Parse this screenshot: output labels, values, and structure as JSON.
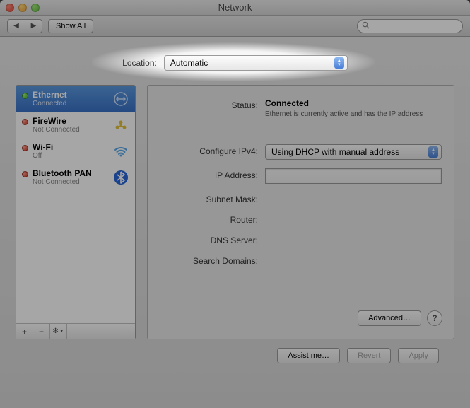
{
  "window": {
    "title": "Network"
  },
  "toolbar": {
    "show_all_label": "Show All",
    "search_placeholder": ""
  },
  "location": {
    "label": "Location:",
    "value": "Automatic"
  },
  "sidebar": {
    "items": [
      {
        "name": "Ethernet",
        "sub": "Connected",
        "status": "green",
        "icon": "ethernet"
      },
      {
        "name": "FireWire",
        "sub": "Not Connected",
        "status": "red",
        "icon": "firewire"
      },
      {
        "name": "Wi-Fi",
        "sub": "Off",
        "status": "red",
        "icon": "wifi"
      },
      {
        "name": "Bluetooth PAN",
        "sub": "Not Connected",
        "status": "red",
        "icon": "bluetooth"
      }
    ],
    "footer": {
      "add": "+",
      "remove": "−",
      "gear": "✻▾"
    }
  },
  "detail": {
    "status_label": "Status:",
    "status_value": "Connected",
    "status_desc": "Ethernet is currently active and has the IP address",
    "config_label": "Configure IPv4:",
    "config_value": "Using DHCP with manual address",
    "ip_label": "IP Address:",
    "ip_value": "",
    "subnet_label": "Subnet Mask:",
    "router_label": "Router:",
    "dns_label": "DNS Server:",
    "search_label": "Search Domains:",
    "advanced_label": "Advanced…",
    "help_label": "?"
  },
  "footer": {
    "assist_label": "Assist me…",
    "revert_label": "Revert",
    "apply_label": "Apply"
  }
}
